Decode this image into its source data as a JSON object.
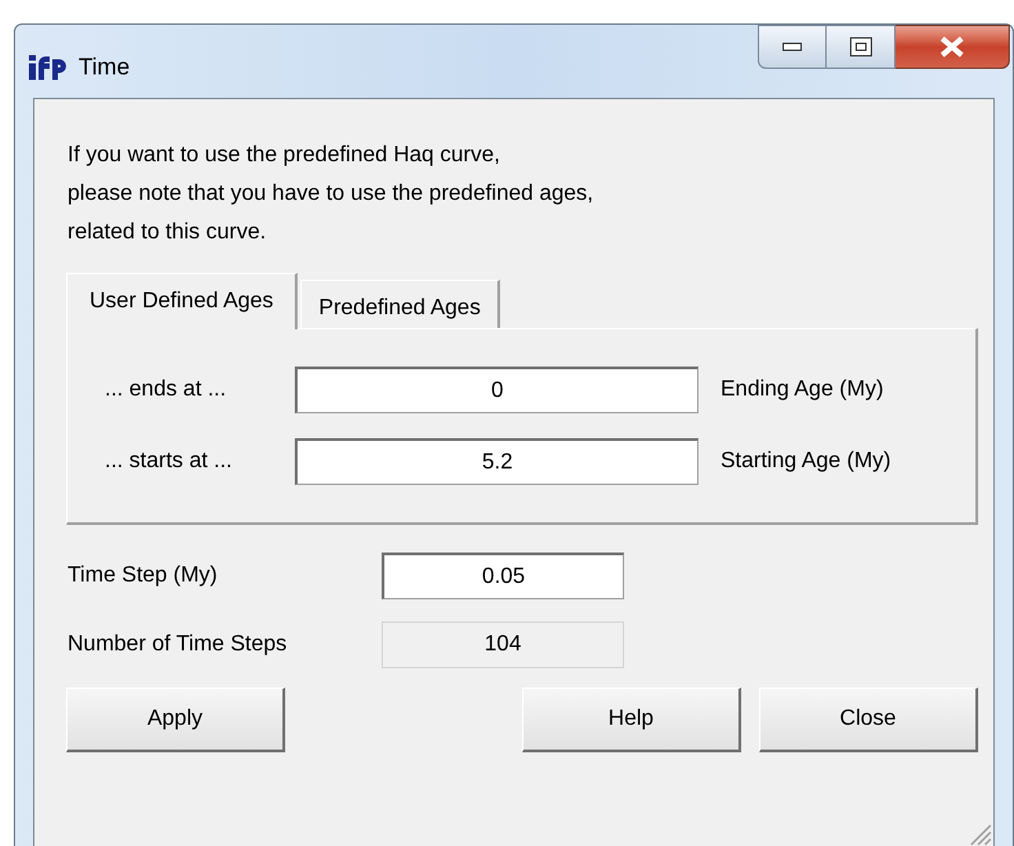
{
  "window": {
    "title": "Time"
  },
  "message": [
    "If you want to use the predefined Haq curve,",
    "please note that you have to use the predefined ages,",
    "related to this curve."
  ],
  "tabs": [
    {
      "label": "User Defined Ages",
      "selected": true
    },
    {
      "label": "Predefined Ages",
      "selected": false
    }
  ],
  "age_fields": [
    {
      "label": "... ends at ...",
      "value": "0",
      "unit": "Ending Age (My)"
    },
    {
      "label": "... starts at ...",
      "value": "5.2",
      "unit": "Starting Age (My)"
    }
  ],
  "time_step": {
    "label": "Time Step (My)",
    "value": "0.05",
    "disabled": false
  },
  "number_of_steps": {
    "label": "Number of Time Steps",
    "value": "104",
    "disabled": true
  },
  "buttons": [
    "Apply",
    "Help",
    "Close"
  ]
}
